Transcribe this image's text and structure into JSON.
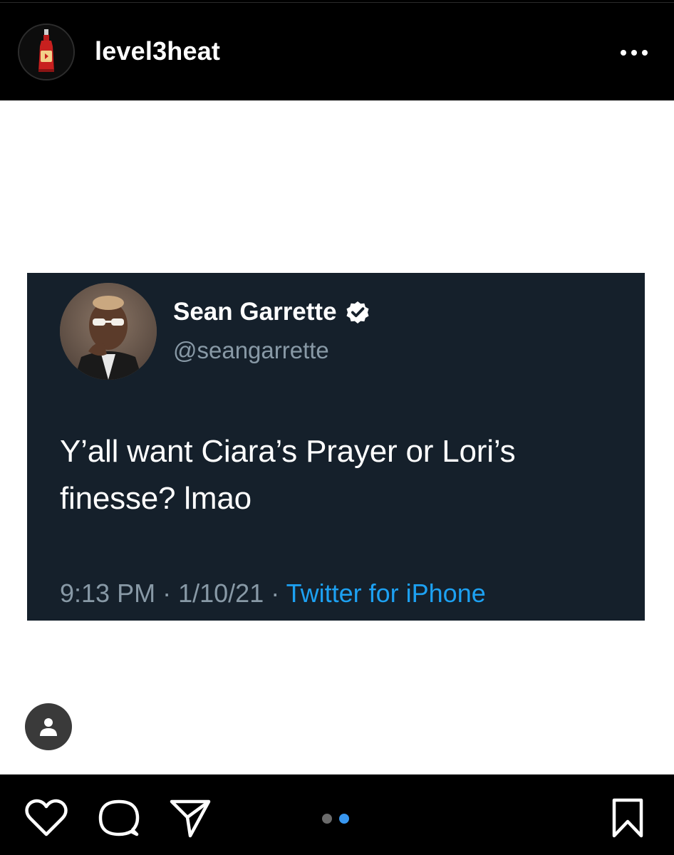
{
  "header": {
    "username": "level3heat",
    "avatar_icon": "hot-sauce-bottle-icon",
    "more_icon": "more-horizontal-icon"
  },
  "post": {
    "background": "#ffffff",
    "tweet": {
      "display_name": "Sean Garrette",
      "verified": true,
      "handle": "@seangarrette",
      "text": "Y’all want Ciara’s Prayer or Lori’s finesse? lmao",
      "time": "9:13 PM",
      "date": "1/10/21",
      "separator": "·",
      "source": "Twitter for iPhone",
      "colors": {
        "background": "#15202b",
        "text": "#ffffff",
        "muted": "#8899a6",
        "link": "#1da1f2"
      }
    },
    "tag_icon": "user-tag-icon"
  },
  "footer": {
    "actions": [
      "heart-icon",
      "comment-icon",
      "share-icon",
      "bookmark-icon"
    ],
    "carousel": {
      "count": 2,
      "active_index": 1,
      "active_color": "#3897f0",
      "inactive_color": "#6b6b6b"
    }
  }
}
